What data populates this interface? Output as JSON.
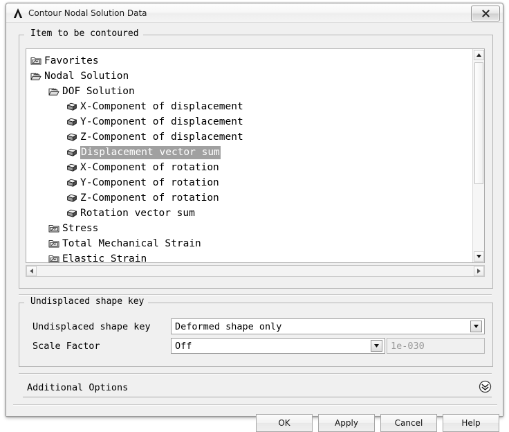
{
  "window": {
    "title": "Contour Nodal Solution Data",
    "app_icon": "ansys-lambda-icon",
    "close_label": "×"
  },
  "item_group": {
    "title": "Item to be contoured",
    "tree": [
      {
        "label": "Favorites",
        "level": 0,
        "icon": "folder-closed-icon",
        "selected": false
      },
      {
        "label": "Nodal Solution",
        "level": 0,
        "icon": "folder-open-icon",
        "selected": false
      },
      {
        "label": "DOF Solution",
        "level": 1,
        "icon": "folder-open-icon",
        "selected": false
      },
      {
        "label": "X-Component of displacement",
        "level": 2,
        "icon": "cube-icon",
        "selected": false
      },
      {
        "label": "Y-Component of displacement",
        "level": 2,
        "icon": "cube-icon",
        "selected": false
      },
      {
        "label": "Z-Component of displacement",
        "level": 2,
        "icon": "cube-icon",
        "selected": false
      },
      {
        "label": "Displacement vector sum",
        "level": 2,
        "icon": "cube-icon",
        "selected": true
      },
      {
        "label": "X-Component of rotation",
        "level": 2,
        "icon": "cube-icon",
        "selected": false
      },
      {
        "label": "Y-Component of rotation",
        "level": 2,
        "icon": "cube-icon",
        "selected": false
      },
      {
        "label": "Z-Component of rotation",
        "level": 2,
        "icon": "cube-icon",
        "selected": false
      },
      {
        "label": "Rotation vector sum",
        "level": 2,
        "icon": "cube-icon",
        "selected": false
      },
      {
        "label": "Stress",
        "level": 1,
        "icon": "folder-closed-icon",
        "selected": false
      },
      {
        "label": "Total Mechanical Strain",
        "level": 1,
        "icon": "folder-closed-icon",
        "selected": false
      },
      {
        "label": "Elastic Strain",
        "level": 1,
        "icon": "folder-closed-icon",
        "selected": false
      }
    ]
  },
  "shape_group": {
    "title": "Undisplaced shape key",
    "rows": [
      {
        "label": "Undisplaced shape key",
        "value": "Deformed shape only"
      },
      {
        "label": "Scale Factor",
        "value": "Off"
      }
    ],
    "scale_factor_value": "1e-030"
  },
  "additional_options": {
    "label": "Additional Options",
    "expander_icon": "chevron-double-down-icon"
  },
  "buttons": [
    {
      "label": "OK"
    },
    {
      "label": "Apply"
    },
    {
      "label": "Cancel"
    },
    {
      "label": "Help"
    }
  ],
  "colors": {
    "dialog_bg": "#f0f0f0",
    "list_bg": "#ffffff",
    "selection_bg": "#a0a0a0",
    "selection_fg": "#ffffff",
    "border": "#b4b4b4",
    "disabled_text": "#999999"
  }
}
